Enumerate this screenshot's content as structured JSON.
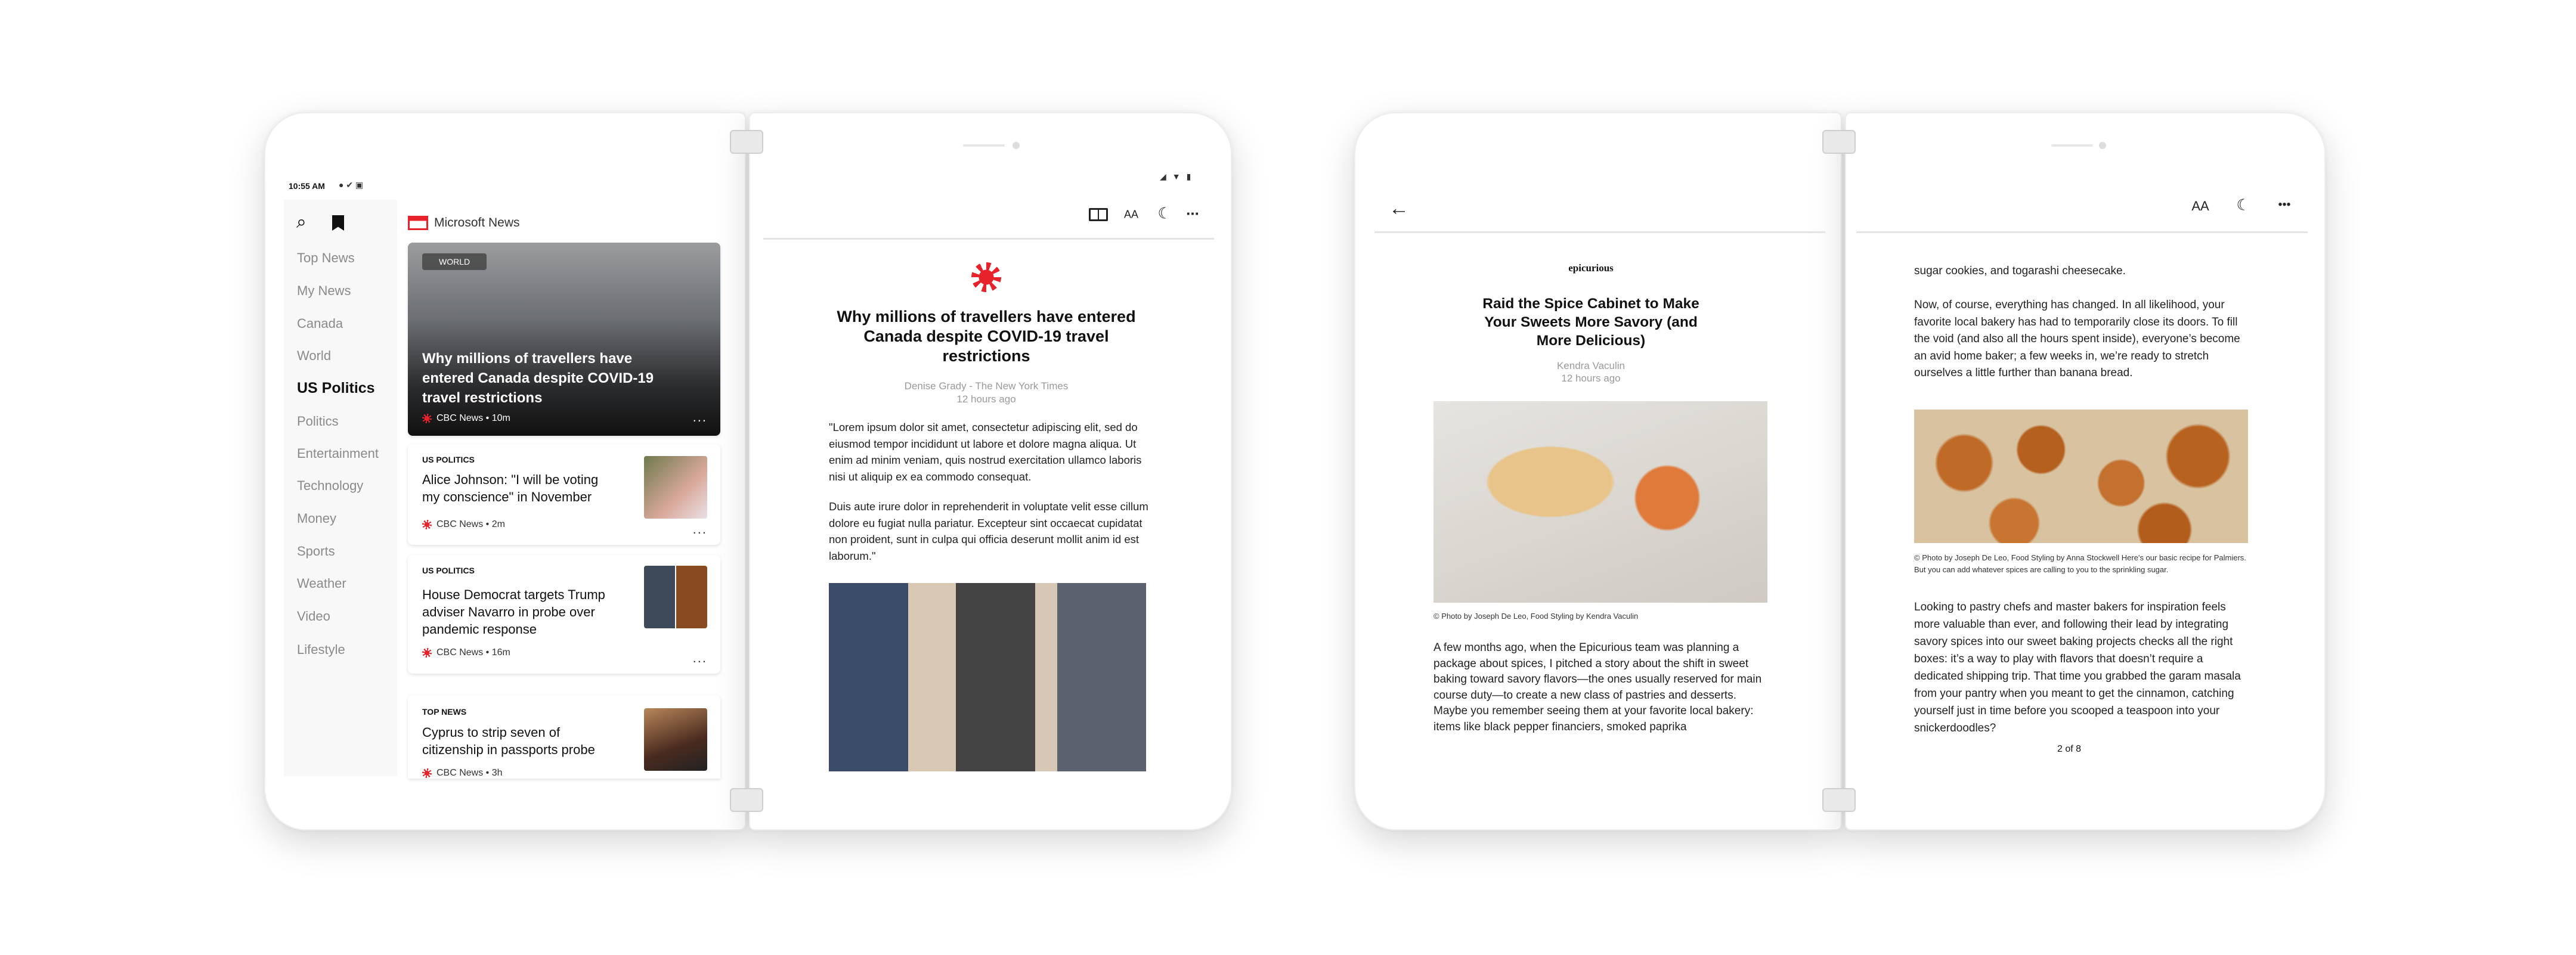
{
  "device1": {
    "status": {
      "time": "10:55 AM"
    },
    "sidebar": {
      "items": [
        {
          "label": "Top News"
        },
        {
          "label": "My News"
        },
        {
          "label": "Canada"
        },
        {
          "label": "World"
        },
        {
          "label": "US Politics",
          "active": true
        },
        {
          "label": "Politics"
        },
        {
          "label": "Entertainment"
        },
        {
          "label": "Technology"
        },
        {
          "label": "Money"
        },
        {
          "label": "Sports"
        },
        {
          "label": "Weather"
        },
        {
          "label": "Video"
        },
        {
          "label": "Lifestyle"
        }
      ]
    },
    "app_name": "Microsoft News",
    "hero": {
      "badge": "WORLD",
      "headline": "Why millions of travellers have entered Canada despite COVID-19 travel restrictions",
      "source": "CBC News • 10m",
      "more": "..."
    },
    "cards": [
      {
        "category": "US POLITICS",
        "headline": "Alice Johnson: \"I will be voting my conscience\" in November",
        "source": "CBC News • 2m",
        "more": "..."
      },
      {
        "category": "US POLITICS",
        "headline": "House Democrat targets Trump adviser Navarro in probe over pandemic response",
        "source": "CBC News • 16m",
        "more": "..."
      },
      {
        "category": "TOP NEWS",
        "headline": "Cyprus to strip seven of citizenship in passports probe",
        "source": "CBC News • 3h"
      }
    ],
    "article": {
      "title": "Why millions of travellers have entered Canada despite COVID-19 travel restrictions",
      "byline": "Denise Grady - The New York Times",
      "time": "12 hours ago",
      "para1": "\"Lorem ipsum dolor sit amet, consectetur adipiscing elit, sed do eiusmod tempor incididunt ut labore et dolore magna aliqua. Ut enim ad minim veniam, quis nostrud exercitation ullamco laboris nisi ut aliquip ex ea commodo consequat.",
      "para2": "Duis aute irure dolor in reprehenderit in voluptate velit esse cillum dolore eu fugiat nulla pariatur. Excepteur sint occaecat cupidatat non proident, sunt in culpa qui officia deserunt mollit anim id est laborum.\""
    },
    "toolbar": {
      "text_size": "AA",
      "more": "..."
    }
  },
  "device2": {
    "publisher": "epicurious",
    "title": "Raid the Spice Cabinet to Make Your Sweets More Savory (and More Delicious)",
    "byline": "Kendra Vaculin",
    "time": "12 hours ago",
    "caption1": "© Photo by Joseph De Leo, Food Styling by Kendra Vaculin",
    "para1": "A few months ago, when the Epicurious team was planning a package about spices, I pitched a story about the shift in sweet baking toward savory flavors—the ones usually reserved for main course duty—to create a new class of pastries and desserts. Maybe you remember seeing them at your favorite local bakery: items like black pepper financiers, smoked paprika",
    "para2": "sugar cookies, and togarashi cheesecake.",
    "para3": "Now, of course, everything has changed. In all likelihood, your favorite local bakery has had to temporarily close its doors. To fill the void (and also all the hours spent inside), everyone’s become an avid home baker; a few weeks in, we’re ready to stretch ourselves a little further than banana bread.",
    "caption2": "© Photo by Joseph De Leo, Food Styling by Anna Stockwell Here's our basic recipe for Palmiers. But you can add whatever spices are calling to you to the sprinkling sugar.",
    "para4": "Looking to pastry chefs and master bakers for inspiration feels more valuable than ever, and following their lead by integrating savory spices into our sweet baking projects checks all the right boxes: it’s a way to play with flavors that doesn’t require a dedicated shipping trip. That time you grabbed the garam masala from your pantry when you meant to get the cinnamon, catching yourself just in time before you scooped a teaspoon into your snickerdoodles?",
    "page_indicator": "2 of 8",
    "toolbar": {
      "text_size": "AA",
      "more": "•••"
    }
  },
  "colors": {
    "accent_red": "#e8222a",
    "sidebar_bg": "#f8f8f8",
    "muted_text": "#8a8a8a"
  }
}
